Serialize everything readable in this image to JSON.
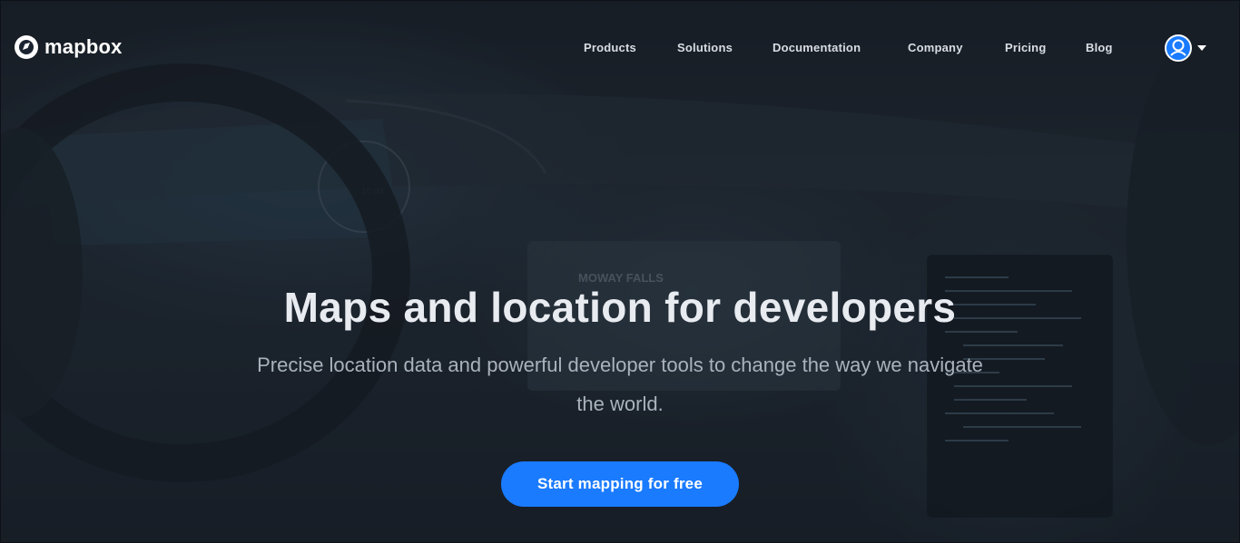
{
  "brand": {
    "name": "mapbox",
    "accent_color": "#1a7bff"
  },
  "nav": {
    "items": [
      {
        "label": "Products"
      },
      {
        "label": "Solutions"
      },
      {
        "label": "Documentation"
      },
      {
        "label": "Company"
      },
      {
        "label": "Pricing"
      },
      {
        "label": "Blog"
      }
    ],
    "account_icon": "user-avatar-icon",
    "account_menu_icon": "caret-down-icon"
  },
  "hero": {
    "title": "Maps and location for developers",
    "subtitle": "Precise location data and powerful developer tools to change the way we navigate the world.",
    "cta_label": "Start mapping for free"
  },
  "background": {
    "dashboard_clock": "10:04",
    "screen_label": "MOWAY FALLS"
  }
}
